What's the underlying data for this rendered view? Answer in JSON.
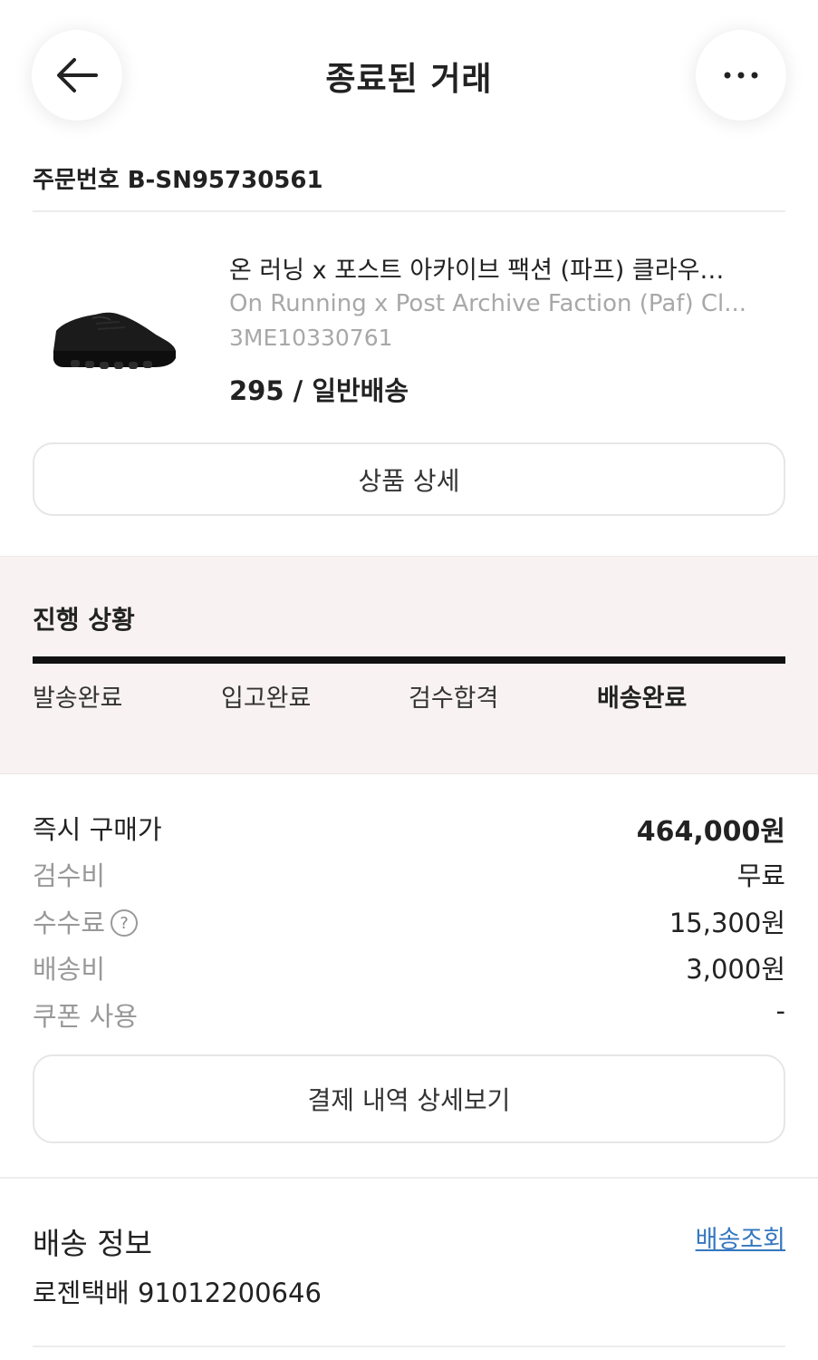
{
  "header": {
    "title": "종료된 거래",
    "back_icon": "arrow-left-icon",
    "more_icon": "more-horizontal-icon"
  },
  "order": {
    "number": "주문번호 B-SN95730561"
  },
  "product": {
    "title_ko": "온 러닝 x 포스트 아카이브 팩션 (파프) 클라우…",
    "title_en": "On Running x Post Archive Faction (Paf) Cl...",
    "code": "3ME10330761",
    "option": "295 / 일반배송",
    "detail_button": "상품 상세"
  },
  "progress": {
    "title": "진행 상황",
    "steps": [
      "발송완료",
      "입고완료",
      "검수합격",
      "배송완료"
    ],
    "current_step_index": 3
  },
  "prices": {
    "rows": [
      {
        "label": "즉시 구매가",
        "value": "464,000원"
      },
      {
        "label": "검수비",
        "value": "무료"
      },
      {
        "label": "수수료",
        "value": "15,300원"
      },
      {
        "label": "배송비",
        "value": "3,000원"
      },
      {
        "label": "쿠폰 사용",
        "value": "-"
      }
    ],
    "help_glyph": "?",
    "pay_button": "결제 내역 상세보기"
  },
  "shipping": {
    "title": "배송 정보",
    "track_link": "배송조회",
    "carrier_info": "로젠택배 91012200646"
  },
  "colors": {
    "progress_bg": "#f9f2f2",
    "link": "#3477c0",
    "muted": "#a8a8a8"
  }
}
